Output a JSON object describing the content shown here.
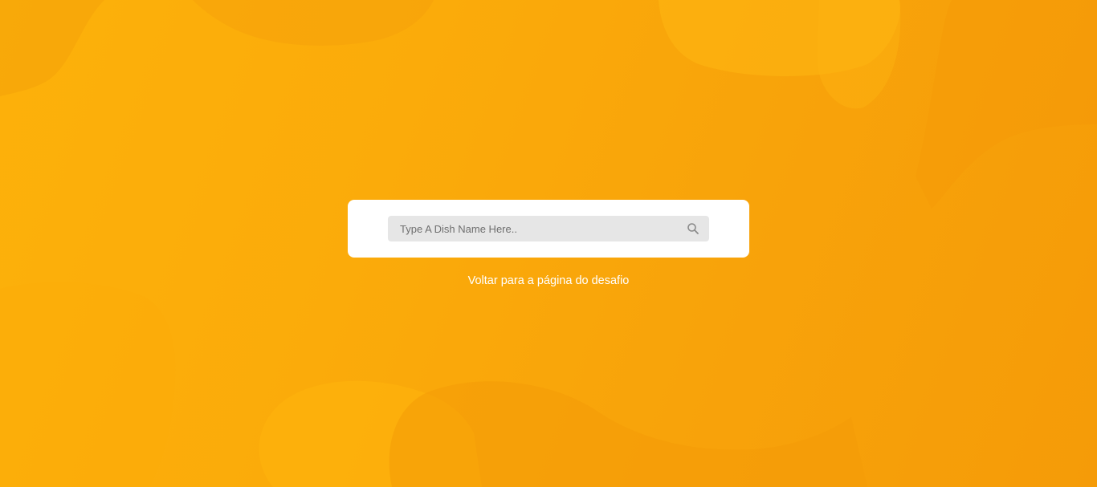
{
  "search": {
    "placeholder": "Type A Dish Name Here..",
    "value": "",
    "icon": "search-icon"
  },
  "footer_link": {
    "label": "Voltar para a página do desafio"
  },
  "colors": {
    "background_start": "#fdb10a",
    "background_end": "#f59b08",
    "card": "#ffffff",
    "input_background": "#e6e6e6",
    "link_text": "#ffffff"
  }
}
